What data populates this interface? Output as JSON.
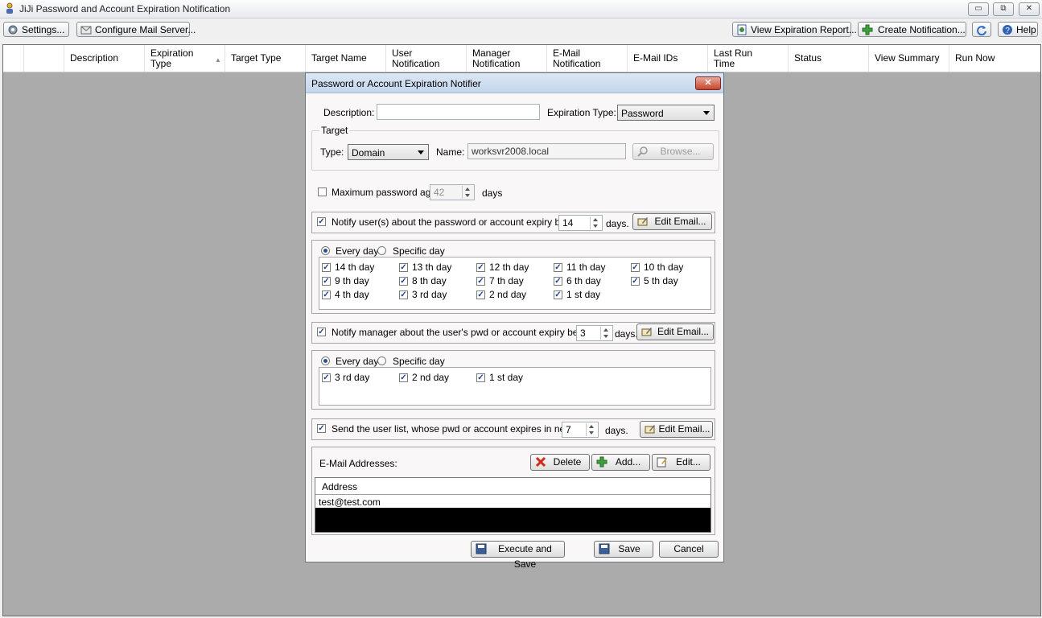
{
  "window": {
    "title": "JiJi Password and Account Expiration Notification",
    "controls": [
      "minimize",
      "restore",
      "close"
    ]
  },
  "toolbar": {
    "settings": "Settings...",
    "configure_mail": "Configure Mail Server...",
    "view_report": "View Expiration Report...",
    "create_notification": "Create Notification...",
    "help": "Help"
  },
  "grid": {
    "columns": [
      "Description",
      "Expiration\nType",
      "Target Type",
      "Target Name",
      "User\nNotification",
      "Manager\nNotification",
      "E-Mail\nNotification",
      "E-Mail IDs",
      "Last Run\nTime",
      "Status",
      "View Summary",
      "Run Now"
    ]
  },
  "dialog": {
    "title": "Password or Account Expiration Notifier",
    "description_label": "Description:",
    "description_value": "",
    "expiration_type_label": "Expiration Type:",
    "expiration_type_value": "Password",
    "target_group": "Target",
    "type_label": "Type:",
    "type_value": "Domain",
    "name_label": "Name:",
    "name_value": "worksvr2008.local",
    "browse": "Browse...",
    "max_age_label": "Maximum password age",
    "max_age_value": "42",
    "max_age_unit": "days",
    "user_notify": {
      "label": "Notify user(s) about the password or account expiry before",
      "value": "14",
      "unit": "days.",
      "edit": "Edit Email...",
      "every_day": "Every day",
      "specific_day": "Specific day",
      "days": [
        "14 th day",
        "13 th day",
        "12 th day",
        "11 th day",
        "10 th day",
        "9 th day",
        "8 th day",
        "7 th day",
        "6 th day",
        "5 th day",
        "4 th day",
        "3 rd day",
        "2 nd day",
        "1 st day"
      ]
    },
    "manager_notify": {
      "label": "Notify  manager about  the user's pwd or account  expiry before",
      "value": "3",
      "unit": "days.",
      "edit": "Edit Email...",
      "every_day": "Every day",
      "specific_day": "Specific day",
      "days": [
        "3 rd day",
        "2 nd day",
        "1 st day"
      ]
    },
    "list_notify": {
      "label": "Send the user list,  whose pwd or account  expires in next",
      "value": "7",
      "unit": "days.",
      "edit": "Edit Email..."
    },
    "email": {
      "label": "E-Mail Addresses:",
      "delete": "Delete",
      "add": "Add...",
      "edit": "Edit...",
      "column": "Address",
      "rows": [
        "test@test.com"
      ]
    },
    "footer": {
      "execute_save": "Execute and Save",
      "save": "Save",
      "cancel": "Cancel"
    }
  },
  "colors": {
    "grid_background": "#ababab",
    "dialog_title": "#c4d6ec",
    "close_button": "#c8442c"
  }
}
